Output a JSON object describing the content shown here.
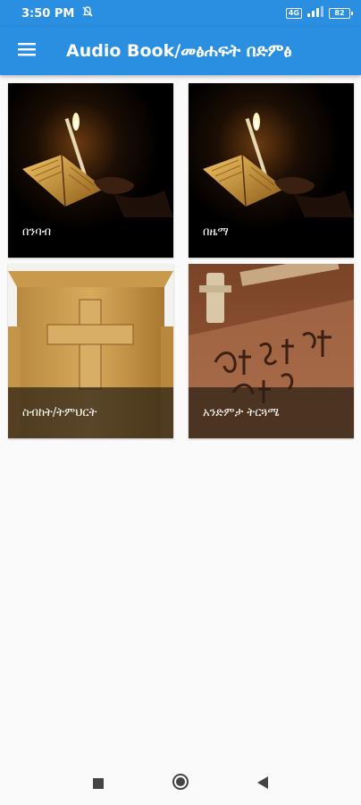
{
  "status_bar": {
    "time": "3:50 PM",
    "network_label": "4G",
    "battery_level": "82"
  },
  "app_bar": {
    "title": "Audio Book/መፅሐፍት በድምፅ",
    "menu_icon": "hamburger-menu-icon"
  },
  "cards": [
    {
      "label": "በንባብ",
      "image": "candle-and-book"
    },
    {
      "label": "በዜማ",
      "image": "candle-and-book"
    },
    {
      "label": "ስብከት/ትምህርት",
      "image": "pulpit-with-cross"
    },
    {
      "label": "አንድምታ ትርጓሜ",
      "image": "geez-manuscript"
    }
  ],
  "nav_bar": {
    "icons": [
      "recents-square-icon",
      "home-circle-icon",
      "back-triangle-icon"
    ]
  },
  "colors": {
    "primary": "#2a8fe0",
    "background": "#fafafa"
  }
}
